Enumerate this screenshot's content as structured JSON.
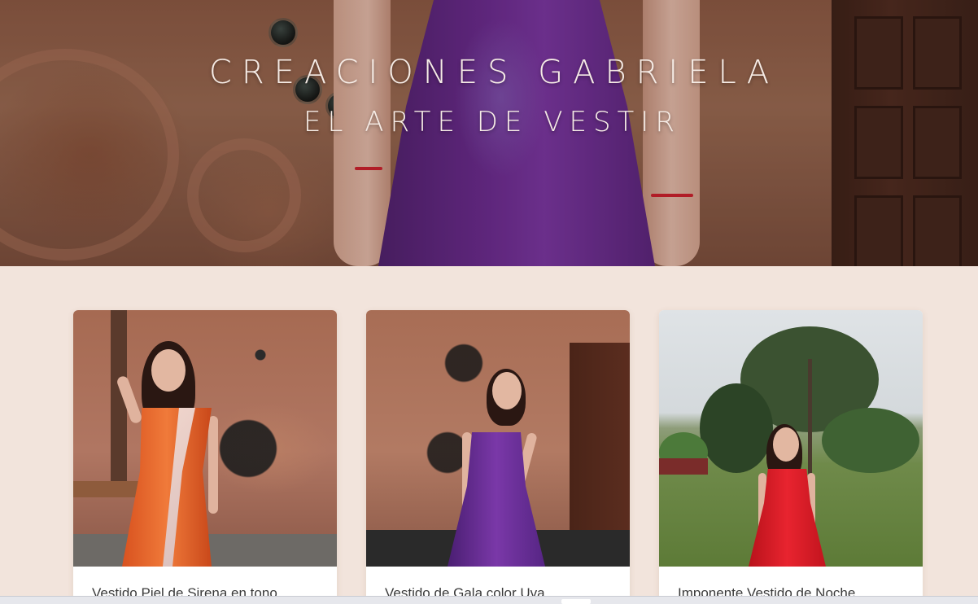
{
  "hero": {
    "title": "CREACIONES GABRIELA",
    "subtitle": "EL ARTE DE VESTIR"
  },
  "products": [
    {
      "caption": "Vestido Piel de Sirena en tono",
      "color": "#e2622c"
    },
    {
      "caption": "Vestido de Gala color Uva",
      "color": "#6a2d98"
    },
    {
      "caption": "Imponente Vestido de Noche",
      "color": "#d61a24"
    }
  ],
  "colors": {
    "background": "#f2e4dc",
    "title_text": "#f6ece6",
    "card": "#ffffff"
  }
}
